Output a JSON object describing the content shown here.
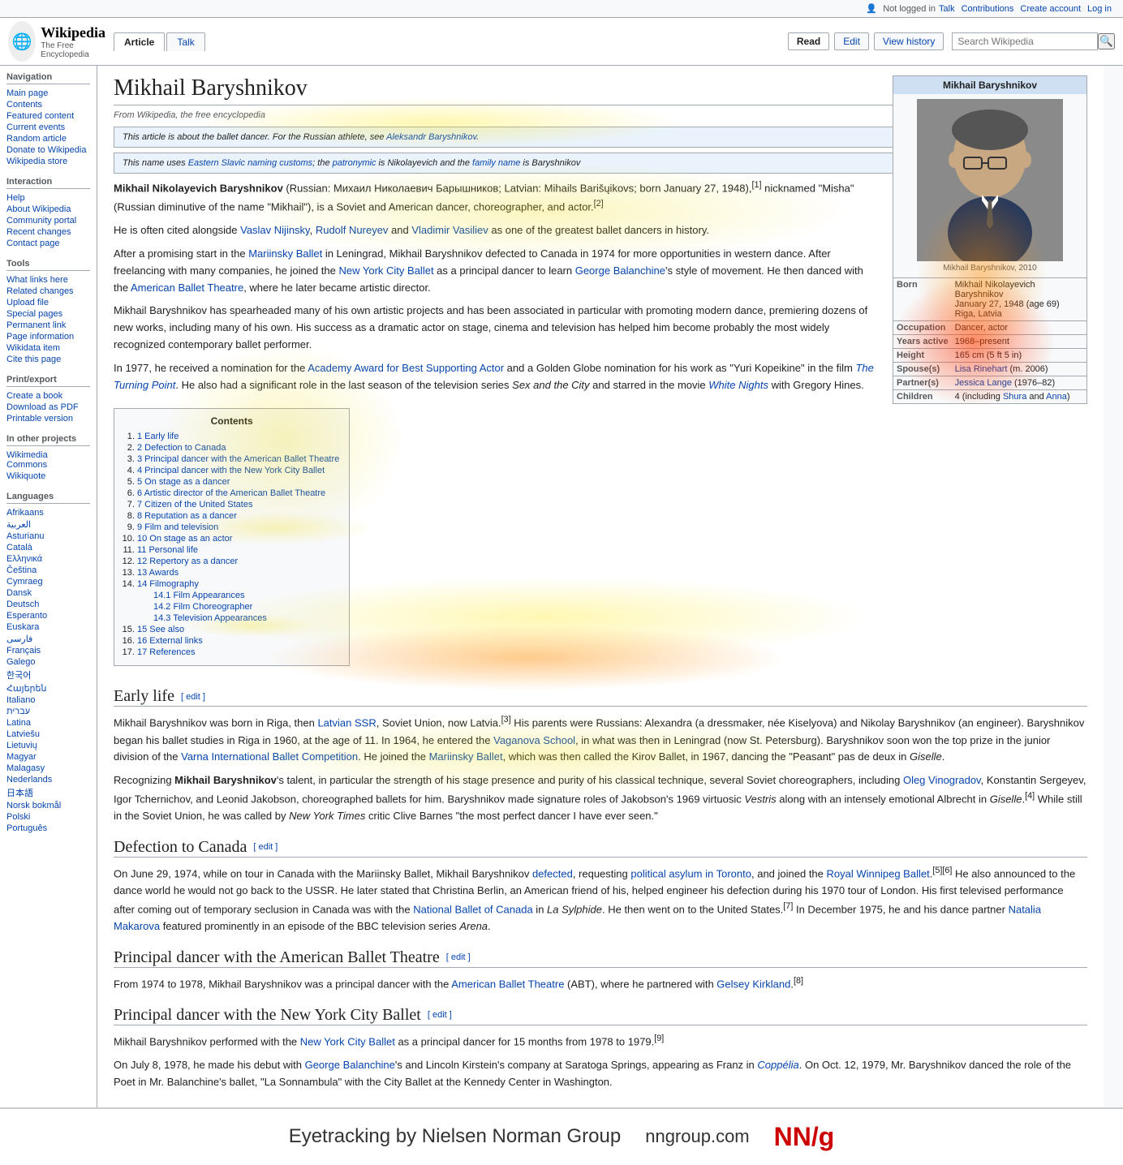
{
  "topbar": {
    "not_logged_in": "Not logged in",
    "talk_label": "Talk",
    "contributions_label": "Contributions",
    "create_account_label": "Create account",
    "log_in_label": "Log in"
  },
  "header": {
    "logo_title": "Wikipedia",
    "logo_subtitle": "The Free Encyclopedia",
    "article_tab": "Article",
    "talk_tab": "Talk",
    "read_tab": "Read",
    "edit_tab": "Edit",
    "view_history_tab": "View history",
    "search_placeholder": "Search Wikipedia"
  },
  "sidebar": {
    "navigation_heading": "Navigation",
    "nav_links": [
      "Main page",
      "Contents",
      "Featured content",
      "Current events",
      "Random article",
      "Donate to Wikipedia",
      "Wikipedia store"
    ],
    "interaction_heading": "Interaction",
    "interaction_links": [
      "Help",
      "About Wikipedia",
      "Community portal",
      "Recent changes",
      "Contact page"
    ],
    "tools_heading": "Tools",
    "tools_links": [
      "What links here",
      "Related changes",
      "Upload file",
      "Special pages",
      "Permanent link",
      "Page information",
      "Wikidata item",
      "Cite this page"
    ],
    "print_heading": "Print/export",
    "print_links": [
      "Create a book",
      "Download as PDF",
      "Printable version"
    ],
    "other_heading": "In other projects",
    "other_links": [
      "Wikimedia Commons",
      "Wikiquote"
    ],
    "languages_heading": "Languages",
    "language_links": [
      "Afrikaans",
      "العربية",
      "Asturianu",
      "Català",
      "Ελληνικά",
      "Čeština",
      "Cymraeg",
      "Dansk",
      "Deutsch",
      "Eλληνικά",
      "Italiano",
      "עברית",
      "Français",
      "Galego",
      "한국어",
      "Հայերեն",
      "Italiano",
      "עברית",
      "Latina",
      "Latviešu",
      "Lietuvių",
      "Magyar",
      "Malagasy",
      "Nederlands",
      "日本語",
      "Norsk bokmål",
      "Polski",
      "Português"
    ]
  },
  "article": {
    "title": "Mikhail Baryshnikov",
    "from_wikipedia": "From Wikipedia, the free encyclopedia",
    "notices": [
      "This article is about the ballet dancer. For the Russian athlete, see Aleksandr Baryshnikov.",
      "This name uses Eastern Slavic naming customs; the patronymic is Nikolayevich and the family name is Baryshnikov"
    ],
    "intro_para1": "Mikhail Nikolayevich Baryshnikov (Russian: Михаил Николаевич Барышников; Latvian: Mihails Barišņikovs; born January 27, 1948),[1] nicknamed \"Misha\" (Russian diminutive of the name \"Mikhail\"), is a Soviet and American dancer, choreographer, and actor.[2]",
    "intro_para2": "He is often cited alongside Vaslav Nijinsky, Rudolf Nureyev and Vladimir Vasiliev as one of the greatest ballet dancers in history.",
    "intro_para3": "After a promising start in the Mariinsky Ballet in Leningrad, Mikhail Baryshnikov defected to Canada in 1974 for more opportunities in western dance. After freelancing with many companies, he joined the New York City Ballet as a principal dancer to learn George Balanchine's style of movement. He then danced with the American Ballet Theatre, where he later became artistic director.",
    "intro_para4": "Mikhail Baryshnikov has spearheaded many of his own artistic projects and has been associated in particular with promoting modern dance, premiering dozens of new works, including many of his own. His success as a dramatic actor on stage, cinema and television has helped him become probably the most widely recognized contemporary ballet performer.",
    "intro_para5": "In 1977, he received a nomination for the Academy Award for Best Supporting Actor and a Golden Globe nomination for his work as \"Yuri Kopeikine\" in the film The Turning Point. He also had a significant role in the last season of the television series Sex and the City and starred in the movie White Nights with Gregory Hines.",
    "infobox": {
      "title": "Mikhail Baryshnikov",
      "image_caption": "Mikhail Baryshnikov, 2010",
      "born_label": "Born",
      "born_value": "Mikhail Nikolayevich Baryshnikov\nJanuary 27, 1948 (age 69)\nRiga, Latvia",
      "occupation_label": "Occupation",
      "occupation_value": "Dancer, actor",
      "years_active_label": "Years active",
      "years_active_value": "1968–present",
      "height_label": "Height",
      "height_value": "165 cm (5 ft 5 in)",
      "spouse_label": "Spouse(s)",
      "spouse_value": "Lisa Rinehart (m. 2006)",
      "partner_label": "Partner(s)",
      "partner_value": "Jessica Lange (1976–82)",
      "children_label": "Children",
      "children_value": "4 (including Shura and Anna)"
    },
    "toc": {
      "title": "Contents",
      "items": [
        {
          "num": "1",
          "text": "Early life"
        },
        {
          "num": "2",
          "text": "Defection to Canada"
        },
        {
          "num": "3",
          "text": "Principal dancer with the American Ballet Theatre"
        },
        {
          "num": "4",
          "text": "Principal dancer with the New York City Ballet"
        },
        {
          "num": "5",
          "text": "On stage as a dancer"
        },
        {
          "num": "6",
          "text": "Artistic director of the American Ballet Theatre"
        },
        {
          "num": "7",
          "text": "Citizen of the United States"
        },
        {
          "num": "8",
          "text": "Reputation as a dancer"
        },
        {
          "num": "9",
          "text": "Film and television"
        },
        {
          "num": "10",
          "text": "On stage as an actor"
        },
        {
          "num": "11",
          "text": "Personal life"
        },
        {
          "num": "12",
          "text": "Repertory as a dancer"
        },
        {
          "num": "13",
          "text": "Awards"
        },
        {
          "num": "14",
          "text": "Filmography"
        },
        {
          "num": "14.1",
          "text": "Film Appearances",
          "sub": true
        },
        {
          "num": "14.2",
          "text": "Film Choreographer",
          "sub": true
        },
        {
          "num": "14.3",
          "text": "Television Appearances",
          "sub": true
        },
        {
          "num": "15",
          "text": "See also"
        },
        {
          "num": "16",
          "text": "External links"
        },
        {
          "num": "17",
          "text": "References"
        }
      ]
    },
    "early_life_title": "Early life",
    "early_life_edit": "edit",
    "early_life_para1": "Mikhail Baryshnikov was born in Riga, then Latvian SSR, Soviet Union, now Latvia.[3] His parents were Russians: Alexandra (a dressmaker, née Kiselyova) and Nikolay Baryshnikov (an engineer). Baryshnikov began his ballet studies in Riga in 1960, at the age of 11. In 1964, he entered the Vaganova School, in what was then in Leningrad (now St. Petersburg). Baryshnikov soon won the top prize in the junior division of the Varna International Ballet Competition. He joined the Mariinsky Ballet, which was then called the Kirov Ballet, in 1967, dancing the \"Peasant\" pas de deux in Giselle.",
    "early_life_para2": "Recognizing Mikhail Baryshnikov's talent, in particular the strength of his stage presence and purity of his classical technique, several Soviet choreographers, including Oleg Vinogradov, Konstantin Sergeyev, Igor Tchernichov, and Leonid Jakobson, choreographed ballets for him. Baryshnikov made signature roles of Jakobson's 1969 virtuosic Vestris along with an intensely emotional Albrecht in Giselle.[4] While still in the Soviet Union, he was called by New York Times critic Clive Barnes \"the most perfect dancer I have ever seen.\"",
    "defection_title": "Defection to Canada",
    "defection_edit": "edit",
    "defection_para1": "On June 29, 1974, while on tour in Canada with the Mariinsky Ballet, Mikhail Baryshnikov defected, requesting political asylum in Toronto, and joined the Royal Winnipeg Ballet.[5][6] He also announced to the dance world he would not go back to the USSR. He later stated that Christina Berlin, an American friend of his, helped engineer his defection during his 1970 tour of London. His first televised performance after coming out of temporary seclusion in Canada was with the National Ballet of Canada in La Sylphide. He then went on to the United States.[7] In December 1975, he and his dance partner Natalia Makarova featured prominently in an episode of the BBC television series Arena.",
    "american_ballet_title": "Principal dancer with the American Ballet Theatre",
    "american_ballet_edit": "edit",
    "american_ballet_para1": "From 1974 to 1978, Mikhail Baryshnikov was a principal dancer with the American Ballet Theatre (ABT), where he partnered with Gelsey Kirkland.[8]",
    "nycb_title": "Principal dancer with the New York City Ballet",
    "nycb_edit": "edit",
    "nycb_para1": "Mikhail Baryshnikov performed with the New York City Ballet as a principal dancer for 15 months from 1978 to 1979.[9]",
    "nycb_para2": "On July 8, 1978, he made his debut with George Balanchine's and Lincoln Kirstein's company at Saratoga Springs, appearing as Franz in Coppélia. On Oct. 12, 1979, Mr. Baryshnikov danced the role of the Poet in Mr. Balanchine's ballet, \"La Sonnambula\" with the City Ballet at the Kennedy Center in Washington."
  },
  "eyetracking": {
    "text": "Eyetracking by Nielsen Norman Group",
    "url": "nngroup.com",
    "logo": "NN/g"
  }
}
